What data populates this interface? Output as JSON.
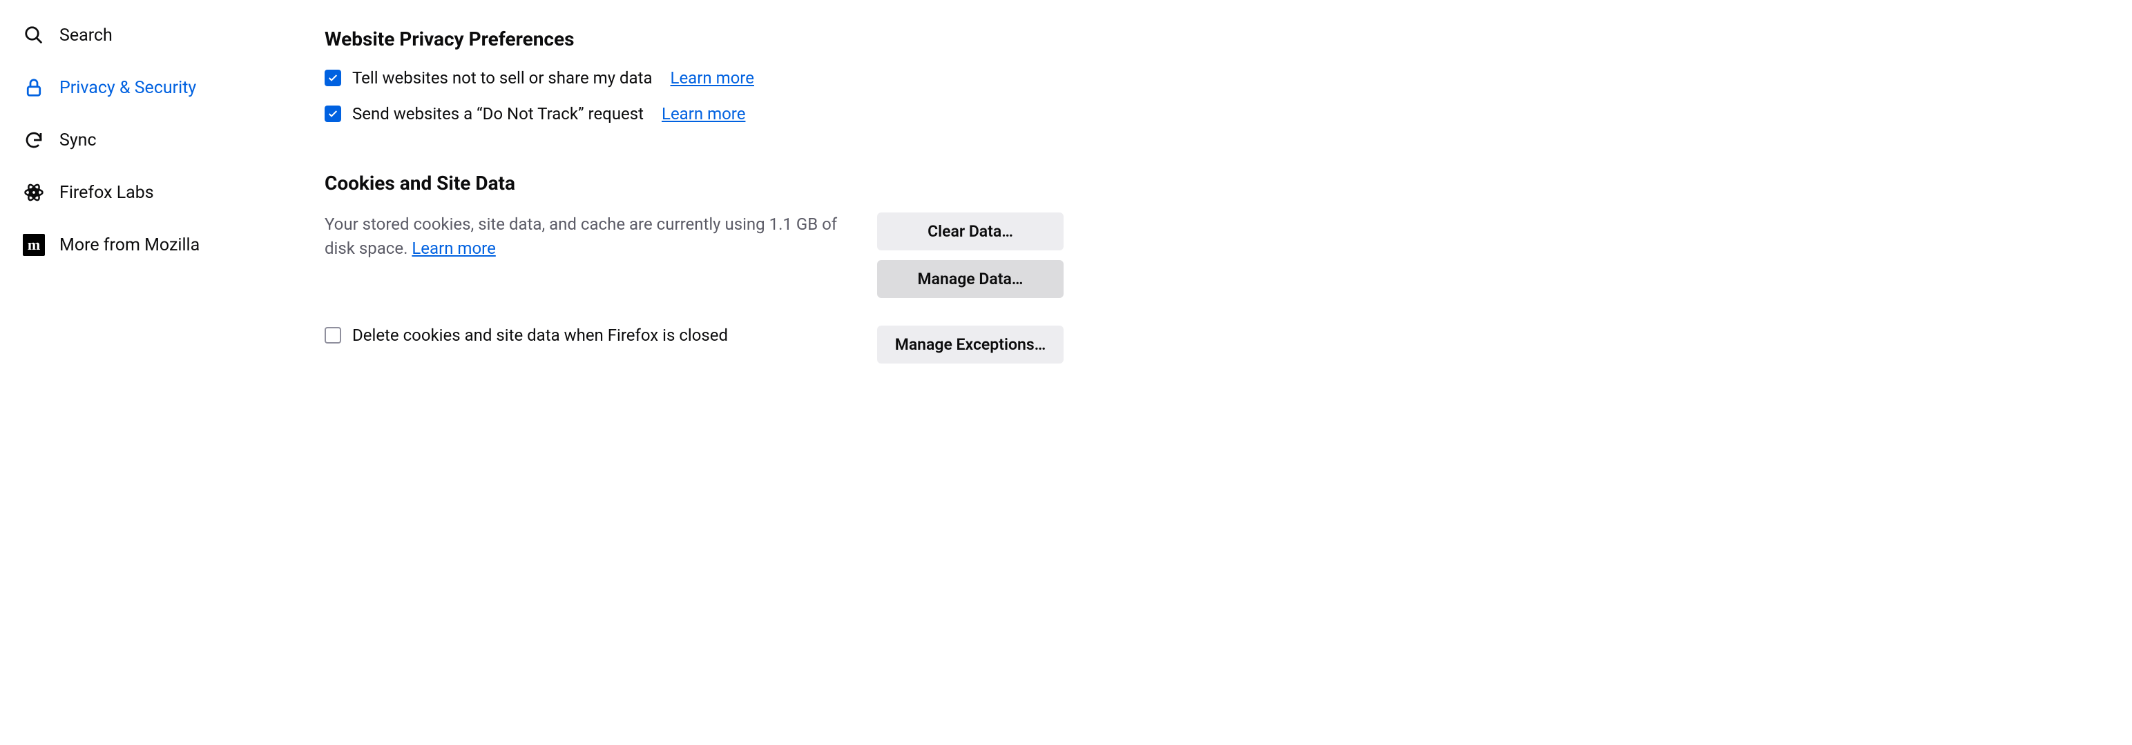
{
  "sidebar": {
    "items": [
      {
        "label": "Search",
        "icon": "search-icon",
        "active": false
      },
      {
        "label": "Privacy & Security",
        "icon": "lock-icon",
        "active": true
      },
      {
        "label": "Sync",
        "icon": "sync-icon",
        "active": false
      },
      {
        "label": "Firefox Labs",
        "icon": "labs-icon",
        "active": false
      },
      {
        "label": "More from Mozilla",
        "icon": "mozilla-icon",
        "active": false
      }
    ]
  },
  "sections": {
    "privacy": {
      "title": "Website Privacy Preferences",
      "options": [
        {
          "label": "Tell websites not to sell or share my data",
          "checked": true,
          "learn_more": "Learn more"
        },
        {
          "label": "Send websites a “Do Not Track” request",
          "checked": true,
          "learn_more": "Learn more"
        }
      ]
    },
    "cookies": {
      "title": "Cookies and Site Data",
      "desc_prefix": "Your stored cookies, site data, and cache are currently using 1.1 GB of disk space. ",
      "learn_more": "Learn more",
      "delete_option": {
        "label": "Delete cookies and site data when Firefox is closed",
        "checked": false
      },
      "buttons": {
        "clear": "Clear Data…",
        "manage": "Manage Data…",
        "exceptions": "Manage Exceptions…"
      }
    }
  },
  "mozilla_glyph": "m"
}
